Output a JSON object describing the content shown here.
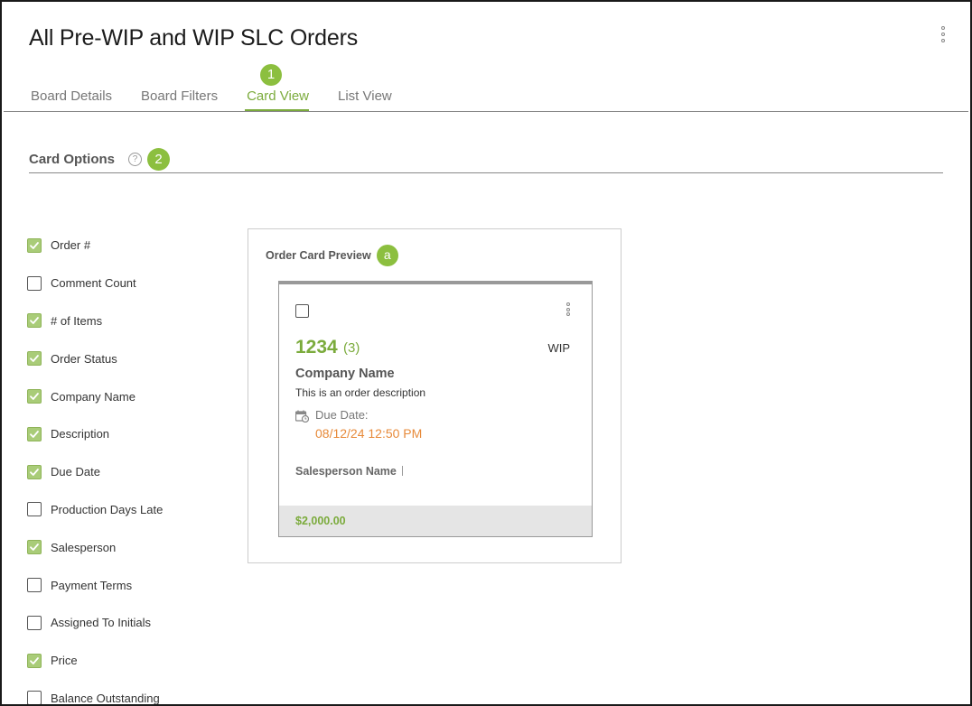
{
  "page": {
    "title": "All Pre-WIP and WIP SLC Orders"
  },
  "tabs": [
    {
      "label": "Board Details",
      "active": false
    },
    {
      "label": "Board Filters",
      "active": false
    },
    {
      "label": "Card View",
      "active": true
    },
    {
      "label": "List View",
      "active": false
    }
  ],
  "callouts": {
    "tabs": "1",
    "card_options": "2",
    "preview": "a"
  },
  "card_options": {
    "title": "Card Options",
    "help_icon": "?",
    "items": [
      {
        "label": "Order #",
        "checked": true
      },
      {
        "label": "Comment Count",
        "checked": false
      },
      {
        "label": "# of Items",
        "checked": true
      },
      {
        "label": "Order Status",
        "checked": true
      },
      {
        "label": "Company Name",
        "checked": true
      },
      {
        "label": "Description",
        "checked": true
      },
      {
        "label": "Due Date",
        "checked": true
      },
      {
        "label": "Production Days Late",
        "checked": false
      },
      {
        "label": "Salesperson",
        "checked": true
      },
      {
        "label": "Payment Terms",
        "checked": false
      },
      {
        "label": "Assigned To Initials",
        "checked": false
      },
      {
        "label": "Price",
        "checked": true
      },
      {
        "label": "Balance Outstanding",
        "checked": false
      }
    ]
  },
  "preview": {
    "title": "Order Card Preview",
    "card": {
      "order_number": "1234",
      "item_count": "(3)",
      "status": "WIP",
      "company": "Company Name",
      "description": "This is an order description",
      "due_label": "Due Date:",
      "due_value": "08/12/24 12:50 PM",
      "salesperson": "Salesperson Name",
      "price": "$2,000.00"
    }
  },
  "colors": {
    "accent_green": "#7bab3c",
    "badge_green": "#8cbf3f",
    "checkbox_green": "#a9cc78",
    "due_orange": "#e78a3a"
  },
  "icons": {
    "more": "vertical-dots-icon",
    "help": "question-circle-icon",
    "calendar": "calendar-clock-icon",
    "check": "checkmark-icon"
  }
}
